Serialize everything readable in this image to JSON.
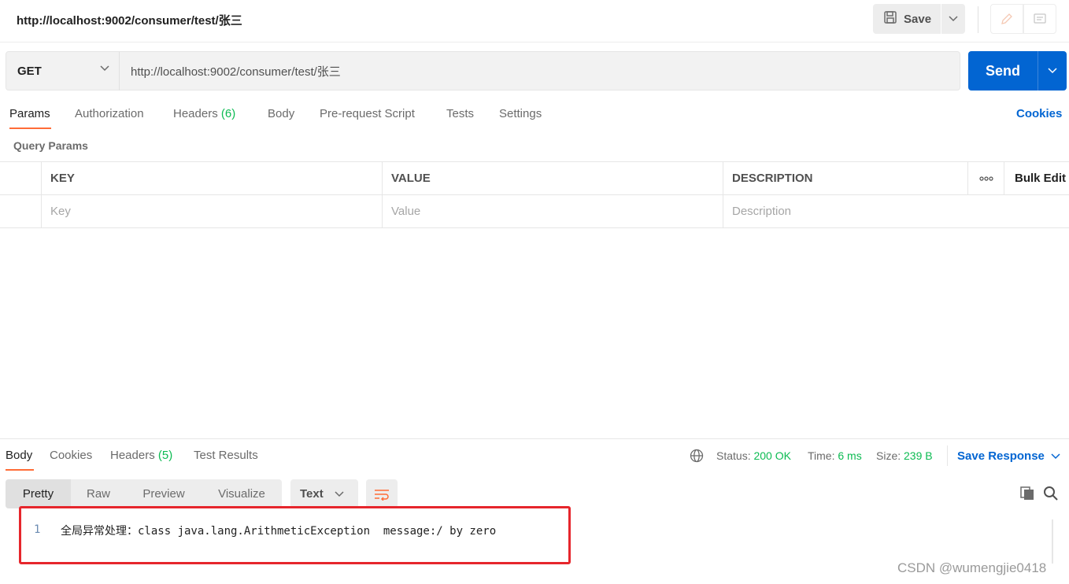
{
  "request": {
    "title": "http://localhost:9002/consumer/test/张三",
    "save_label": "Save",
    "method": "GET",
    "url": "http://localhost:9002/consumer/test/张三",
    "send_label": "Send"
  },
  "request_tabs": [
    {
      "label": "Params",
      "count": ""
    },
    {
      "label": "Authorization",
      "count": ""
    },
    {
      "label": "Headers",
      "count": "(6)"
    },
    {
      "label": "Body",
      "count": ""
    },
    {
      "label": "Pre-request Script",
      "count": ""
    },
    {
      "label": "Tests",
      "count": ""
    },
    {
      "label": "Settings",
      "count": ""
    }
  ],
  "cookies_label": "Cookies",
  "query_params": {
    "title": "Query Params",
    "columns": [
      "KEY",
      "VALUE",
      "DESCRIPTION"
    ],
    "bulk_edit": "Bulk Edit",
    "placeholders": [
      "Key",
      "Value",
      "Description"
    ]
  },
  "response": {
    "tabs": [
      {
        "label": "Body",
        "count": ""
      },
      {
        "label": "Cookies",
        "count": ""
      },
      {
        "label": "Headers",
        "count": "(5)"
      },
      {
        "label": "Test Results",
        "count": ""
      }
    ],
    "status_label": "Status:",
    "status_value": "200 OK",
    "time_label": "Time:",
    "time_value": "6 ms",
    "size_label": "Size:",
    "size_value": "239 B",
    "save_response": "Save Response",
    "views": [
      "Pretty",
      "Raw",
      "Preview",
      "Visualize"
    ],
    "format": "Text",
    "line_number": "1",
    "body_line": "全局异常处理：class java.lang.ArithmeticException  message:/ by zero"
  },
  "colors": {
    "accent_orange": "#ff6c37",
    "primary_blue": "#0265d2",
    "success_green": "#0cbb52",
    "highlight_red": "#e6262c"
  },
  "watermark": "CSDN @wumengjie0418"
}
